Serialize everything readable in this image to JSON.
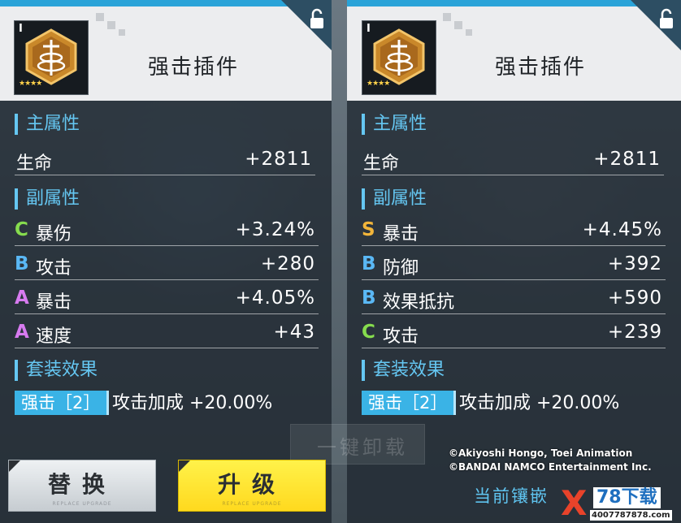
{
  "left": {
    "tier": "I",
    "stars": "★★★★",
    "name": "强击插件",
    "main_title": "主属性",
    "main_stat": {
      "name": "生命",
      "value": "+2811"
    },
    "sub_title": "副属性",
    "substats": [
      {
        "grade": "C",
        "name": "暴伤",
        "value": "+3.24%"
      },
      {
        "grade": "B",
        "name": "攻击",
        "value": "+280"
      },
      {
        "grade": "A",
        "name": "暴击",
        "value": "+4.05%"
      },
      {
        "grade": "A",
        "name": "速度",
        "value": "+43"
      }
    ],
    "set_title": "套装效果",
    "set_tag": "强击［2］",
    "set_effect": "攻击加成  +20.00%"
  },
  "right": {
    "tier": "I",
    "stars": "★★★★",
    "name": "强击插件",
    "main_title": "主属性",
    "main_stat": {
      "name": "生命",
      "value": "+2811"
    },
    "sub_title": "副属性",
    "substats": [
      {
        "grade": "S",
        "name": "暴击",
        "value": "+4.45%"
      },
      {
        "grade": "B",
        "name": "防御",
        "value": "+392"
      },
      {
        "grade": "B",
        "name": "效果抵抗",
        "value": "+590"
      },
      {
        "grade": "C",
        "name": "攻击",
        "value": "+239"
      }
    ],
    "set_title": "套装效果",
    "set_tag": "强击［2］",
    "set_effect": "攻击加成  +20.00%"
  },
  "grade_colors": {
    "S": "#f2b53a",
    "A": "#d77bf0",
    "B": "#5ab8f5",
    "C": "#86dc4e"
  },
  "buttons": {
    "replace": "替换",
    "upgrade": "升级",
    "sub_text": "REPLACE UPGRADE"
  },
  "unload_label": "一键卸载",
  "copyright": {
    "line1": "©Akiyoshi Hongo, Toei Animation",
    "line2": "©BANDAI NAMCO Entertainment Inc."
  },
  "current_label": "当前镶嵌",
  "watermark": {
    "x": "X",
    "title": "78下载",
    "url": "4007787878.com"
  }
}
